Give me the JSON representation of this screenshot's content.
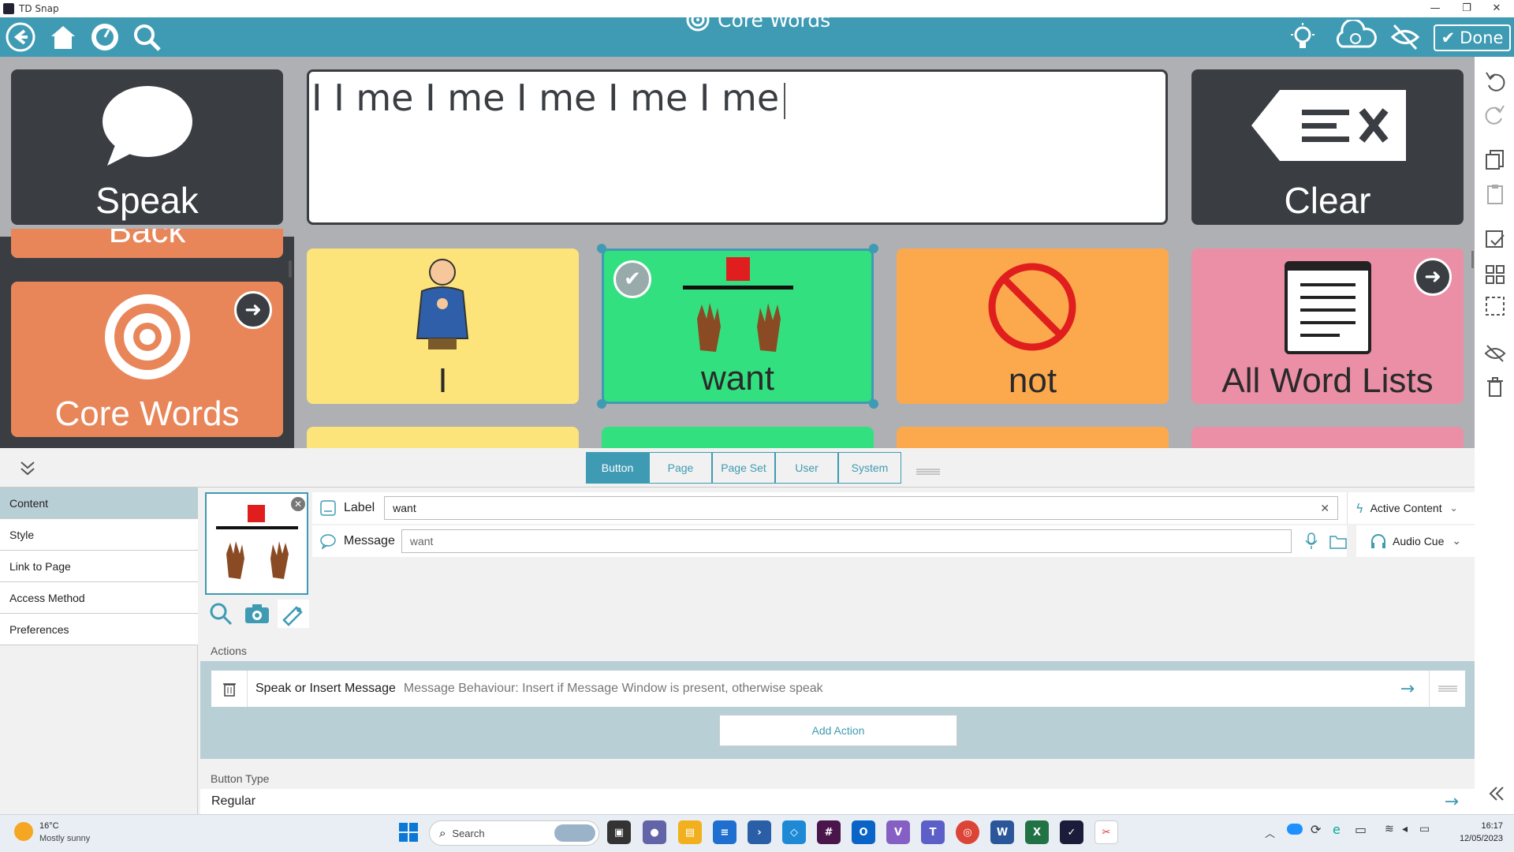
{
  "window": {
    "title": "TD Snap",
    "minimize": "—",
    "restore": "❐",
    "close": "✕"
  },
  "toolbar": {
    "title": "Core Words",
    "done_label": "Done",
    "icons": [
      "back-icon",
      "home-icon",
      "dashboard-icon",
      "search-icon",
      "lightbulb-icon",
      "cloud-sync-icon",
      "hide-icon",
      "check-icon"
    ]
  },
  "message_bar": {
    "speak_label": "Speak",
    "clear_label": "Clear",
    "text": "I I me I me I me I me I me"
  },
  "grid": {
    "back_partial": "Back",
    "core_words": "Core Words",
    "cells": [
      {
        "label": "I",
        "color": "#fde47a"
      },
      {
        "label": "want",
        "color": "#33e07f"
      },
      {
        "label": "not",
        "color": "#fca94e"
      },
      {
        "label": "All Word Lists",
        "color": "#eb8fa6"
      }
    ]
  },
  "editor": {
    "tabs": [
      {
        "label": "Button",
        "active": true
      },
      {
        "label": "Page"
      },
      {
        "label": "Page Set"
      },
      {
        "label": "User"
      },
      {
        "label": "System"
      }
    ],
    "nav": [
      {
        "label": "Content",
        "active": true
      },
      {
        "label": "Style"
      },
      {
        "label": "Link to Page"
      },
      {
        "label": "Access Method"
      },
      {
        "label": "Preferences"
      }
    ],
    "label_caption": "Label",
    "label_value": "want",
    "message_caption": "Message",
    "message_value": "want",
    "active_content": "Active Content",
    "audio_cue": "Audio Cue",
    "actions_caption": "Actions",
    "action_name": "Speak or Insert Message",
    "action_desc": "Message Behaviour: Insert if Message Window is present, otherwise speak",
    "add_action": "Add Action",
    "button_type_caption": "Button Type",
    "button_type_value": "Regular"
  },
  "taskbar": {
    "temp": "16°C",
    "weather": "Mostly sunny",
    "search": "Search",
    "time": "16:17",
    "date": "12/05/2023"
  }
}
